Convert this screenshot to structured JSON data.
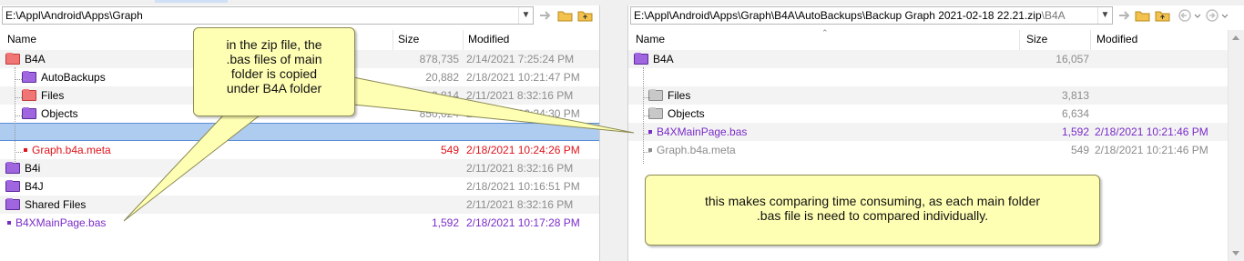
{
  "left": {
    "path": "E:\\Appl\\Android\\Apps\\Graph",
    "columns": {
      "name": "Name",
      "size": "Size",
      "modified": "Modified"
    },
    "rows": [
      {
        "name": "B4A",
        "size": "878,735",
        "modified": "2/14/2021 7:25:24 PM",
        "icon": "folder-red",
        "color": "gray"
      },
      {
        "name": "AutoBackups",
        "size": "20,882",
        "modified": "2/18/2021 10:21:47 PM",
        "icon": "folder-purple",
        "color": "gray"
      },
      {
        "name": "Files",
        "size": "3,814",
        "modified": "2/11/2021 8:32:16 PM",
        "icon": "folder-red",
        "color": "gray"
      },
      {
        "name": "Objects",
        "size": "850,024",
        "modified": "2/18/2021 10:24:30 PM",
        "icon": "folder-purple",
        "color": "gray"
      },
      {
        "name": "",
        "size": "",
        "modified": "",
        "icon": "none",
        "color": "gray"
      },
      {
        "name": "Graph.b4a.meta",
        "size": "549",
        "modified": "2/18/2021 10:24:26 PM",
        "icon": "file-red",
        "color": "red"
      },
      {
        "name": "B4i",
        "size": "",
        "modified": "2/11/2021 8:32:16 PM",
        "icon": "folder-purple",
        "color": "gray"
      },
      {
        "name": "B4J",
        "size": "",
        "modified": "2/18/2021 10:16:51 PM",
        "icon": "folder-purple",
        "color": "gray"
      },
      {
        "name": "Shared Files",
        "size": "",
        "modified": "2/11/2021 8:32:16 PM",
        "icon": "folder-purple",
        "color": "gray"
      },
      {
        "name": "B4XMainPage.bas",
        "size": "1,592",
        "modified": "2/18/2021 10:17:28 PM",
        "icon": "file-purple",
        "color": "purple"
      }
    ]
  },
  "right": {
    "path": "E:\\Appl\\Android\\Apps\\Graph\\B4A\\AutoBackups\\Backup Graph 2021-02-18 22.21.zip",
    "path_suffix": "\\B4A",
    "columns": {
      "name": "Name",
      "size": "Size",
      "modified": "Modified"
    },
    "rows": [
      {
        "name": "B4A",
        "size": "16,057",
        "modified": "",
        "icon": "folder-purple",
        "color": "gray"
      },
      {
        "name": "",
        "size": "",
        "modified": "",
        "icon": "none",
        "color": "gray"
      },
      {
        "name": "Files",
        "size": "3,813",
        "modified": "",
        "icon": "folder-gray",
        "color": "gray"
      },
      {
        "name": "Objects",
        "size": "6,634",
        "modified": "",
        "icon": "folder-gray",
        "color": "gray"
      },
      {
        "name": "B4XMainPage.bas",
        "size": "1,592",
        "modified": "2/18/2021 10:21:46 PM",
        "icon": "file-purple",
        "color": "purple"
      },
      {
        "name": "Graph.b4a.meta",
        "size": "549",
        "modified": "2/18/2021 10:21:46 PM",
        "icon": "file-gray",
        "color": "gray"
      }
    ]
  },
  "callouts": {
    "zip": [
      "in the zip file, the",
      ".bas files of main",
      "folder is copied",
      "under B4A folder"
    ],
    "compare": [
      "this makes comparing time consuming, as each main folder",
      ".bas file is need to compared individually."
    ]
  },
  "colors": {
    "selected_row": "#aecbf0",
    "callout_bg": "#ffffb4",
    "red_text": "#e0141c",
    "purple_text": "#7a2cc8",
    "gray_text": "#8c8c8c"
  }
}
